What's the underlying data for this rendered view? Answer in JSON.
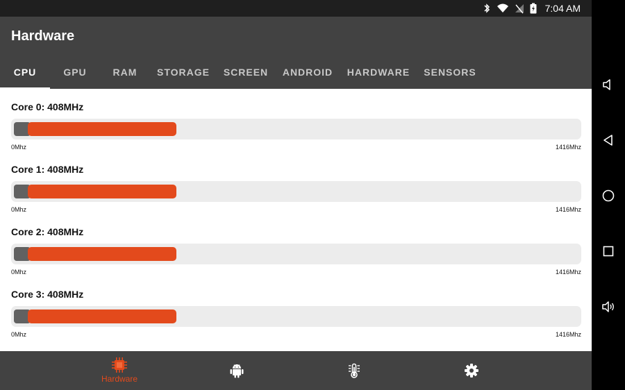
{
  "status_bar": {
    "time": "7:04 AM"
  },
  "app_bar": {
    "title": "Hardware"
  },
  "tabs": [
    {
      "label": "CPU",
      "active": true
    },
    {
      "label": "GPU",
      "active": false
    },
    {
      "label": "RAM",
      "active": false
    },
    {
      "label": "STORAGE",
      "active": false
    },
    {
      "label": "SCREEN",
      "active": false
    },
    {
      "label": "ANDROID",
      "active": false
    },
    {
      "label": "HARDWARE",
      "active": false
    },
    {
      "label": "SENSORS",
      "active": false
    }
  ],
  "cores": [
    {
      "label": "Core 0: 408MHz",
      "min_label": "0Mhz",
      "max_label": "1416Mhz",
      "value_mhz": 408,
      "max_mhz": 1416
    },
    {
      "label": "Core 1: 408MHz",
      "min_label": "0Mhz",
      "max_label": "1416Mhz",
      "value_mhz": 408,
      "max_mhz": 1416
    },
    {
      "label": "Core 2: 408MHz",
      "min_label": "0Mhz",
      "max_label": "1416Mhz",
      "value_mhz": 408,
      "max_mhz": 1416
    },
    {
      "label": "Core 3: 408MHz",
      "min_label": "0Mhz",
      "max_label": "1416Mhz",
      "value_mhz": 408,
      "max_mhz": 1416
    }
  ],
  "bottom_nav": {
    "items": [
      {
        "icon": "cpu-chip-icon",
        "label": "Hardware",
        "active": true
      },
      {
        "icon": "android-icon",
        "label": "",
        "active": false
      },
      {
        "icon": "thermometer-icon",
        "label": "",
        "active": false
      },
      {
        "icon": "gear-icon",
        "label": "",
        "active": false
      }
    ]
  },
  "colors": {
    "accent": "#e34a1c",
    "app_bar": "#424242",
    "status_bar": "#1f1f1f",
    "track": "#ececec",
    "bar_base": "#616161"
  }
}
